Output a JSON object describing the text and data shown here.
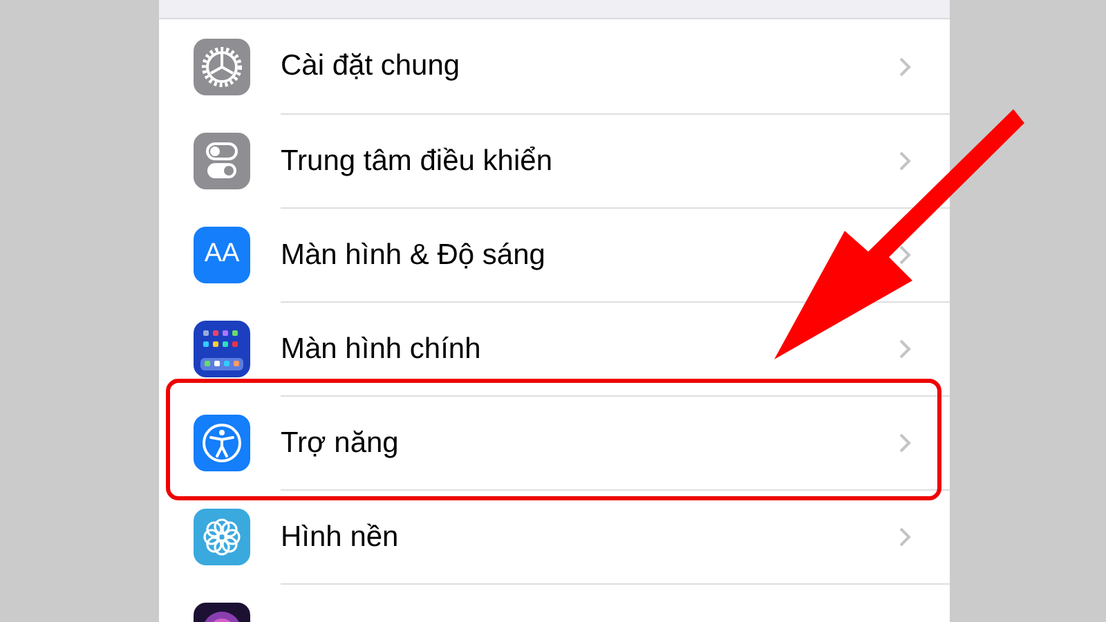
{
  "settings_rows": [
    {
      "label": "Cài đặt chung",
      "kind": "gear",
      "highlighted": false
    },
    {
      "label": "Trung tâm điều khiển",
      "kind": "toggles",
      "highlighted": false
    },
    {
      "label": "Màn hình & Độ sáng",
      "kind": "text",
      "icon_text": "AA",
      "highlighted": false
    },
    {
      "label": "Màn hình chính",
      "kind": "grid",
      "highlighted": false
    },
    {
      "label": "Trợ năng",
      "kind": "accessibility",
      "highlighted": true
    },
    {
      "label": "Hình nền",
      "kind": "flower",
      "highlighted": false
    },
    {
      "kind": "orb",
      "highlighted": false
    }
  ],
  "annotation": {
    "kind": "arrow"
  }
}
